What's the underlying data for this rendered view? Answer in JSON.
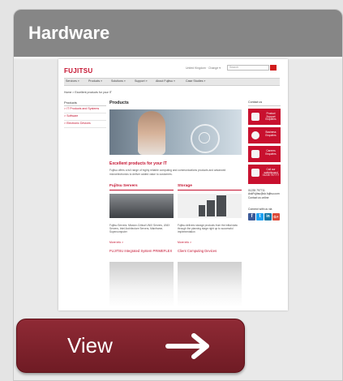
{
  "card": {
    "title": "Hardware"
  },
  "screenshot": {
    "logo": "FUJITSU",
    "region": "United Kingdom · Change ▾",
    "search_placeholder": "Search",
    "nav": [
      "Services »",
      "Products »",
      "Solutions »",
      "Support »",
      "About Fujitsu »",
      "Case Studies »"
    ],
    "breadcrumb": "Home > Excellent products for your IT",
    "sidebar_heading": "Products",
    "sidebar_items": [
      "> IT Products and Systems",
      "> Software",
      "> Electronic Devices"
    ],
    "page_title": "Products",
    "tagline": "Excellent products for your IT",
    "intro": "Fujitsu offers a full range of highly reliable computing and communications products and advanced microelectronics to deliver added value to customers.",
    "col1_title": "Fujitsu Servers",
    "col2_title": "Storage",
    "col1_text": "Fujitsu Servers: Mission-Critical UNIX Servers, UNIX Servers, Intel Architecture Servers, Mainframe, Supercomputer",
    "col2_text": "Fujitsu delivers storage products from the initial data through the planning stage right up to successful implementation",
    "more_link": "More info >",
    "col1_next_title": "FUJITSU Integrated System PRIMEFLEX",
    "col2_next_title": "Client Computing Devices",
    "contact_heading": "Contact us",
    "contact_buttons": [
      "Product Support Enquiries",
      "Business Enquiries",
      "Careers Enquiries",
      "Call our switchboard 01235 797777"
    ],
    "phone_lines": [
      "01235 797711",
      "AskFujitsu@uk.fujitsu.com",
      "Contact us online"
    ],
    "connect_heading": "Connect with us via",
    "social_icons": [
      "f",
      "t",
      "in",
      "G+"
    ]
  },
  "view_button": {
    "label": "View",
    "icon": "arrow-right-icon"
  },
  "colors": {
    "header": "#868686",
    "button": "#7c2029",
    "brand_red": "#c4122f"
  }
}
